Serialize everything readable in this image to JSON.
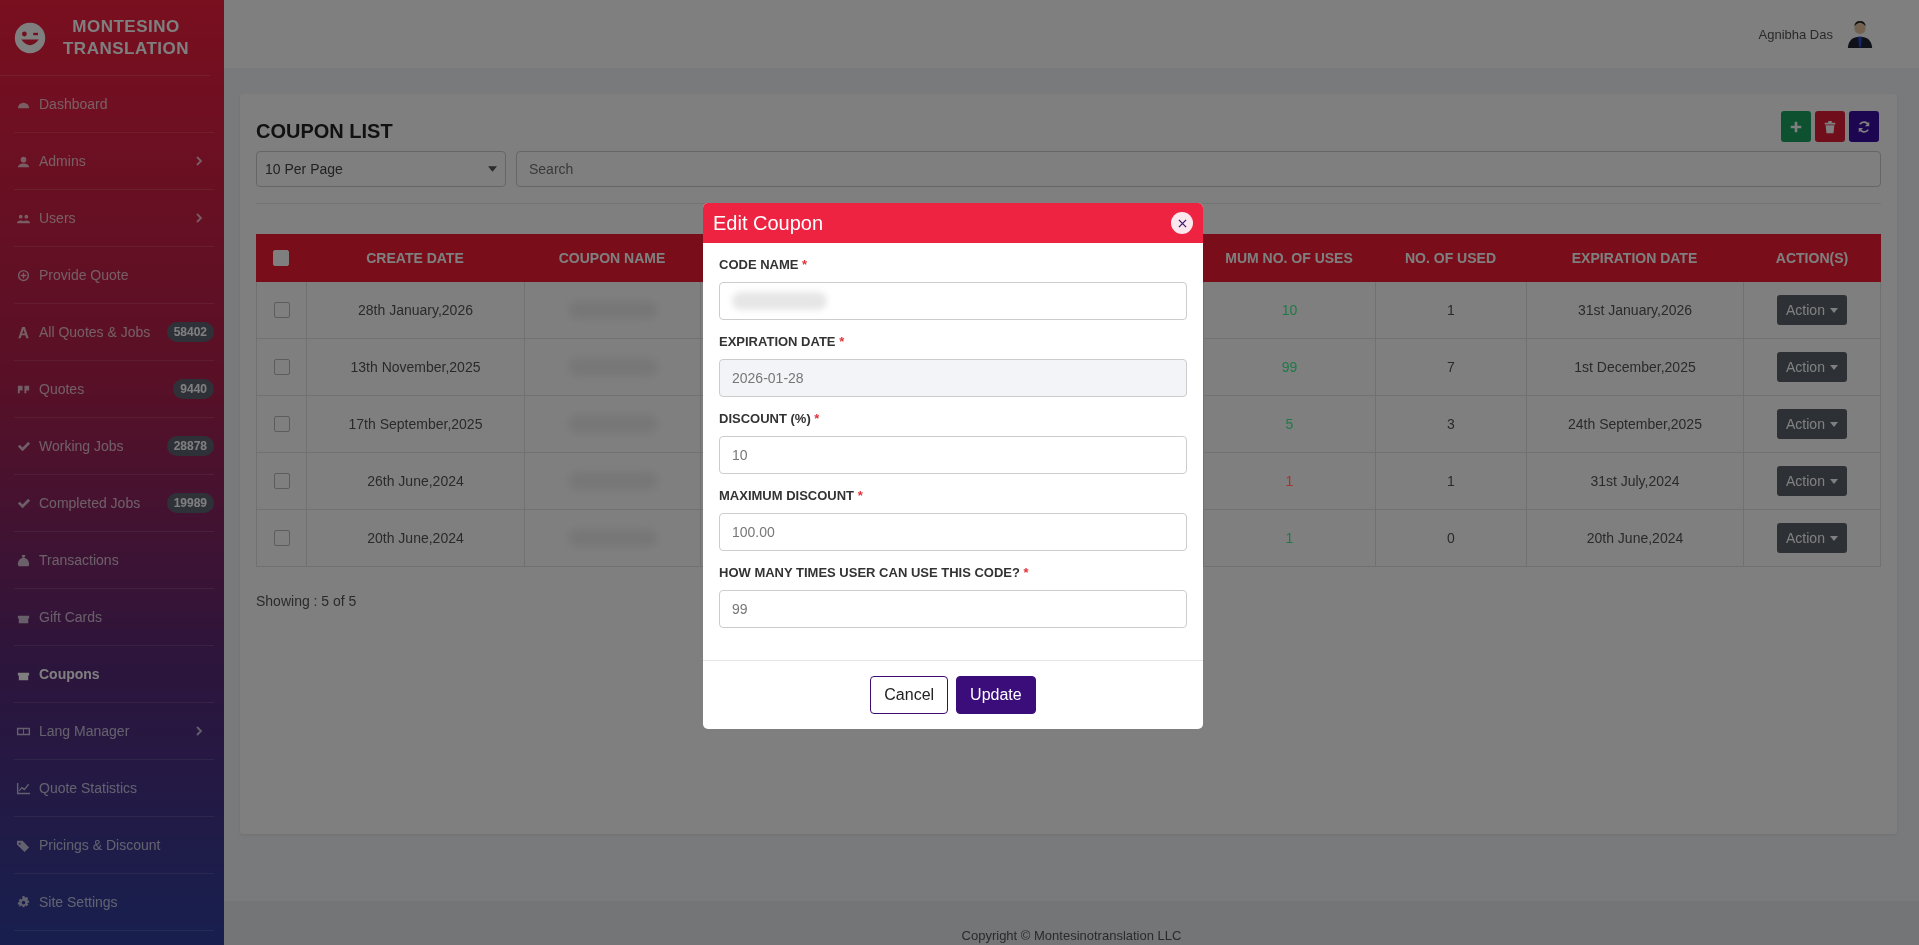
{
  "sidebar": {
    "brand": "MONTESINO TRANSLATION",
    "items": [
      {
        "label": "Dashboard",
        "selected": false,
        "expandable": false
      },
      {
        "label": "Admins",
        "selected": false,
        "expandable": true
      },
      {
        "label": "Users",
        "selected": false,
        "expandable": true
      },
      {
        "label": "Provide Quote",
        "selected": false,
        "expandable": false
      },
      {
        "label": "All Quotes & Jobs",
        "badge": "58402",
        "selected": false,
        "expandable": false
      },
      {
        "label": "Quotes",
        "badge": "9440",
        "selected": false,
        "expandable": false
      },
      {
        "label": "Working Jobs",
        "badge": "28878",
        "selected": false,
        "expandable": false
      },
      {
        "label": "Completed Jobs",
        "badge": "19989",
        "selected": false,
        "expandable": false
      },
      {
        "label": "Transactions",
        "selected": false,
        "expandable": false
      },
      {
        "label": "Gift Cards",
        "selected": false,
        "expandable": false
      },
      {
        "label": "Coupons",
        "selected": true,
        "expandable": false
      },
      {
        "label": "Lang Manager",
        "selected": false,
        "expandable": true
      },
      {
        "label": "Quote Statistics",
        "selected": false,
        "expandable": false
      },
      {
        "label": "Pricings & Discount",
        "selected": false,
        "expandable": false
      },
      {
        "label": "Site Settings",
        "selected": false,
        "expandable": false
      }
    ]
  },
  "header": {
    "user_name": "Agnibha Das"
  },
  "page": {
    "title": "COUPON LIST",
    "per_page": "10 Per Page",
    "search": {
      "placeholder": "Search"
    }
  },
  "table": {
    "select_all": {
      "checked": false
    },
    "columns": [
      "CREATE DATE",
      "COUPON NAME",
      "MUM NO. OF USES",
      "NO. OF USED",
      "EXPIRATION DATE",
      "ACTION(S)"
    ],
    "rows": [
      {
        "checked": false,
        "create_date": "28th January,2026",
        "uses": "10",
        "color": "#1e7b46",
        "used": "1",
        "expiration": "31st January,2026",
        "action": "Action"
      },
      {
        "checked": false,
        "create_date": "13th November,2025",
        "uses": "99",
        "color": "#1e7b46",
        "used": "7",
        "expiration": "1st December,2025",
        "action": "Action"
      },
      {
        "checked": false,
        "create_date": "17th September,2025",
        "uses": "5",
        "color": "#1e7b46",
        "used": "3",
        "expiration": "24th September,2025",
        "action": "Action"
      },
      {
        "checked": false,
        "create_date": "26th June,2024",
        "uses": "1",
        "color": "#a8322e",
        "used": "1",
        "expiration": "31st July,2024",
        "action": "Action"
      },
      {
        "checked": false,
        "create_date": "20th June,2024",
        "uses": "1",
        "color": "#1e7b46",
        "used": "0",
        "expiration": "20th June,2024",
        "action": "Action"
      }
    ]
  },
  "showing": "Showing : 5 of 5",
  "footer": "Copyright © Montesinotranslation LLC",
  "modal": {
    "title": "Edit Coupon",
    "fields": [
      {
        "label": "CODE NAME",
        "required_mark": "*",
        "redacted": true
      },
      {
        "label": "EXPIRATION DATE",
        "required_mark": "*",
        "value": "2026-01-28",
        "redacted": false,
        "readonly": true
      },
      {
        "label": "DISCOUNT (%)",
        "required_mark": "*",
        "value": "10",
        "redacted": false,
        "readonly": false
      },
      {
        "label": "MAXIMUM DISCOUNT",
        "required_mark": "*",
        "value": "100.00",
        "redacted": false,
        "readonly": false
      },
      {
        "label": "HOW MANY TIMES USER CAN USE THIS CODE?",
        "required_mark": "*",
        "value": "99",
        "redacted": false,
        "readonly": false
      }
    ],
    "cancel": "Cancel",
    "update": "Update"
  }
}
